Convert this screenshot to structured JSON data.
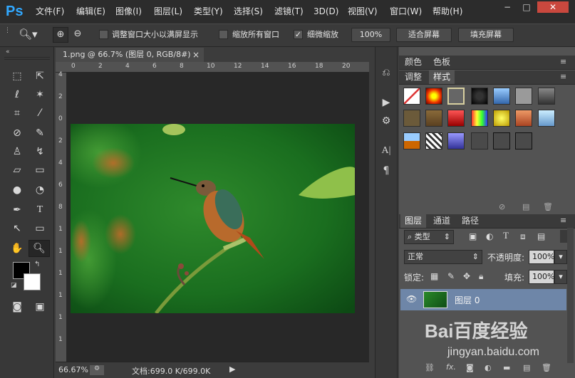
{
  "app": {
    "logo": "Ps"
  },
  "menu": [
    "文件(F)",
    "编辑(E)",
    "图像(I)",
    "图层(L)",
    "类型(Y)",
    "选择(S)",
    "滤镜(T)",
    "3D(D)",
    "视图(V)",
    "窗口(W)",
    "帮助(H)"
  ],
  "window_controls": {
    "minimize": "−",
    "maximize": "□",
    "close": "✕"
  },
  "options": {
    "resize_windows_label": "调整窗口大小以满屏显示",
    "zoom_all_label": "缩放所有窗口",
    "scrubby_zoom_label": "细微缩放",
    "scrubby_zoom_checked": true,
    "btn_100": "100%",
    "btn_fit": "适合屏幕",
    "btn_fill": "填充屏幕"
  },
  "document": {
    "tab_title": "1.png @ 66.7% (图层 0, RGB/8#)",
    "tab_close": "×",
    "ruler_h": [
      "0",
      "2",
      "4",
      "6",
      "8",
      "10",
      "12",
      "14",
      "16",
      "18",
      "20"
    ],
    "ruler_v": [
      "4",
      "2",
      "0",
      "2",
      "4",
      "6",
      "8",
      "1",
      "1",
      "1",
      "1",
      "1",
      "1"
    ],
    "zoom": "66.67%",
    "status": "文档:699.0 K/699.0K"
  },
  "panels": {
    "top_tabs": [
      "颜色",
      "色板"
    ],
    "style_tabs": [
      "调整",
      "样式"
    ],
    "layers_tabs": [
      "图层",
      "通道",
      "路径"
    ],
    "filter_kind": "类型",
    "blend_mode": "正常",
    "opacity_label": "不透明度:",
    "opacity_value": "100%",
    "lock_label": "锁定:",
    "fill_label": "填充:",
    "fill_value": "100%",
    "layer_name": "图层 0"
  },
  "watermark": {
    "text": "Bai百度经验",
    "url": "jingyan.baidu.com"
  }
}
